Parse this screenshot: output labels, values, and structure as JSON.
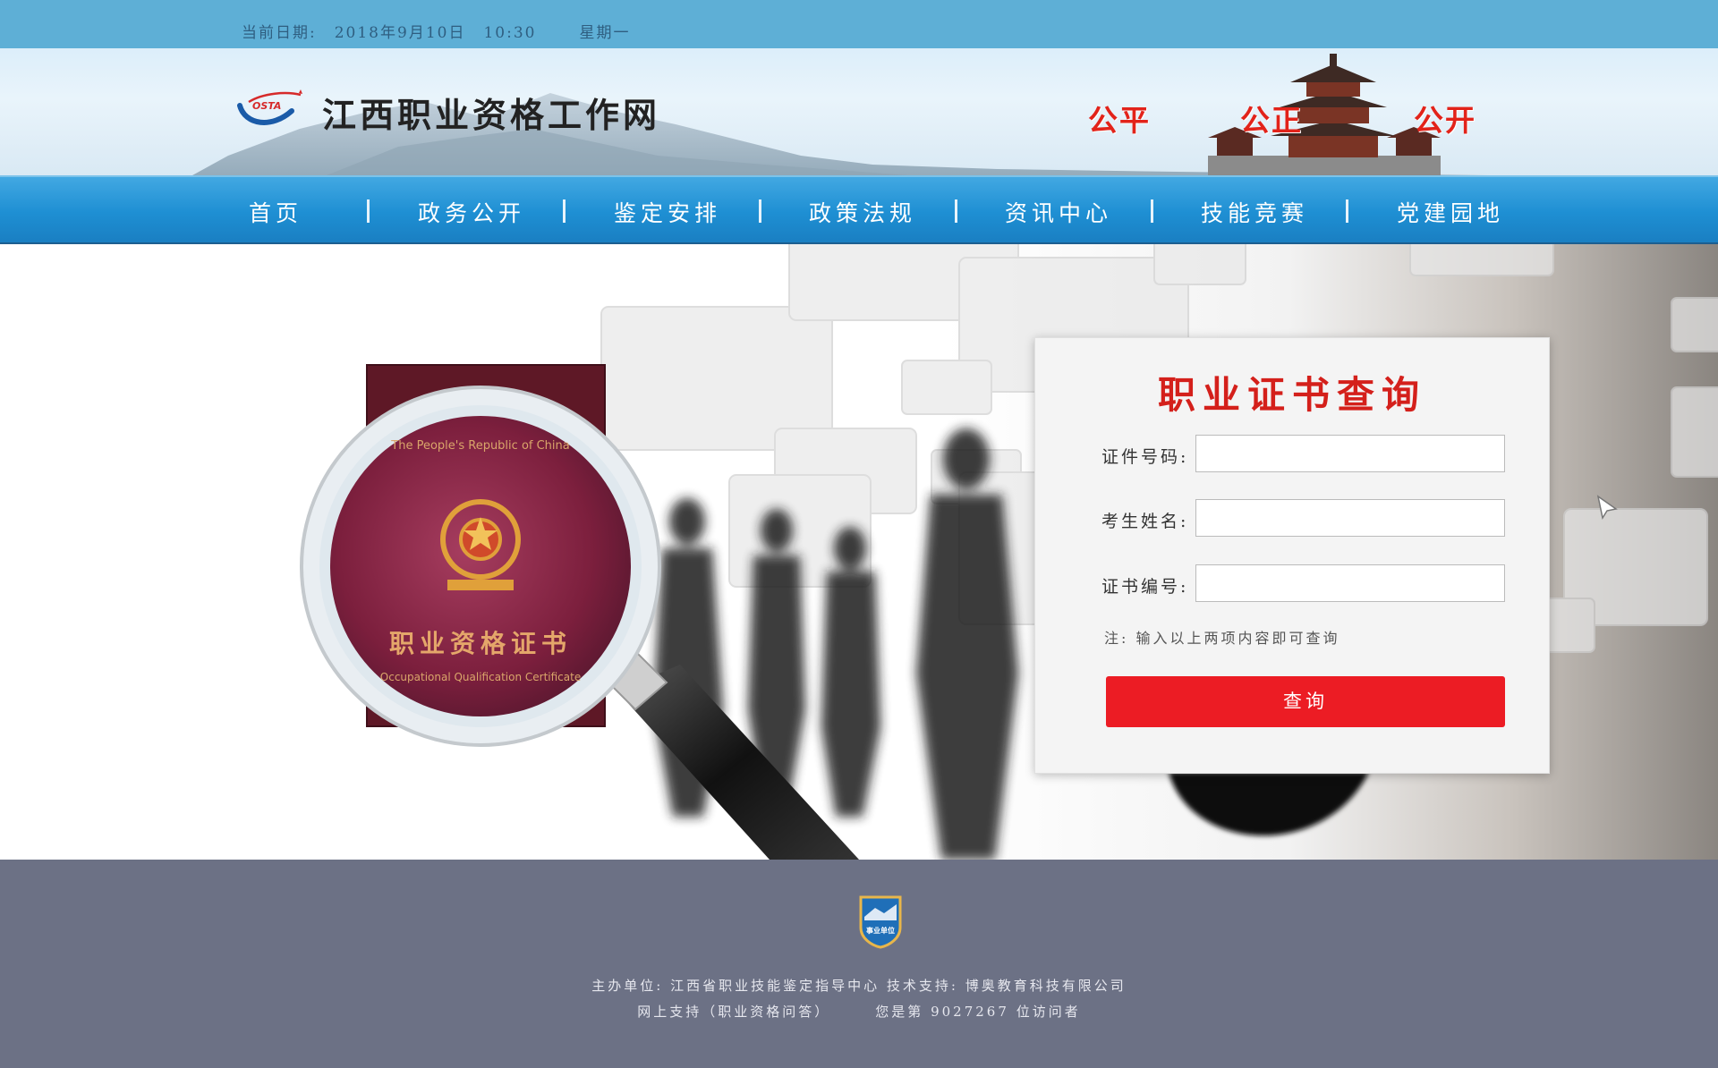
{
  "topbar": {
    "date_label": "当前日期:",
    "date": "2018年9月10日",
    "time": "10:30",
    "weekday": "星期一"
  },
  "header": {
    "site_title": "江西职业资格工作网",
    "logo_text": "OSTA",
    "slogans": [
      "公平",
      "公正",
      "公开"
    ]
  },
  "nav": {
    "items": [
      "首页",
      "政务公开",
      "鉴定安排",
      "政策法规",
      "资讯中心",
      "技能竞赛",
      "党建园地"
    ]
  },
  "hero": {
    "certificate_top_text": "The People's Republic of China",
    "certificate_title": "职业资格证书",
    "certificate_bottom_text": "Occupational Qualification Certificate"
  },
  "query_form": {
    "title": "职业证书查询",
    "fields": [
      {
        "label": "证件号码:",
        "value": ""
      },
      {
        "label": "考生姓名:",
        "value": ""
      },
      {
        "label": "证书编号:",
        "value": ""
      }
    ],
    "note": "注: 输入以上两项内容即可查询",
    "submit_label": "查询"
  },
  "footer": {
    "badge_text": "事业单位",
    "sponsor_label": "主办单位:",
    "sponsor": "江西省职业技能鉴定指导中心",
    "tech_label": "技术支持:",
    "tech": "博奥教育科技有限公司",
    "support": "网上支持（职业资格问答）",
    "visitor_prefix": "您是第",
    "visitor_count": "9027267",
    "visitor_suffix": "位访问者"
  },
  "colors": {
    "topbar": "#5eafd6",
    "nav": "#1e8fd3",
    "accent_red": "#ec1c24",
    "footer": "#6c7185"
  }
}
